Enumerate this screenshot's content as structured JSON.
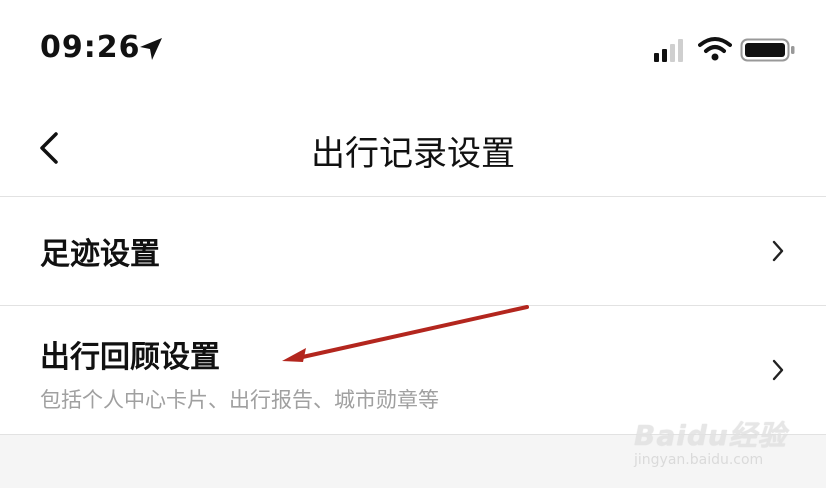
{
  "status_bar": {
    "time": "09:26",
    "icons": [
      "location-arrow-icon",
      "cellular-signal-icon",
      "wifi-icon",
      "battery-icon"
    ]
  },
  "nav": {
    "title": "出行记录设置",
    "back_icon": "chevron-left-icon"
  },
  "rows": [
    {
      "title": "足迹设置",
      "subtitle": "",
      "icon": "chevron-right-icon"
    },
    {
      "title": "出行回顾设置",
      "subtitle": "包括个人中心卡片、出行报告、城市勋章等",
      "icon": "chevron-right-icon"
    }
  ],
  "annotation": {
    "color": "#b3261e"
  },
  "watermark": {
    "brand": "Baidu经验",
    "url": "jingyan.baidu.com"
  },
  "colors": {
    "divider": "#e2e2e2",
    "subtitle": "#a0a0a0",
    "background_bottom": "#f5f5f5"
  }
}
